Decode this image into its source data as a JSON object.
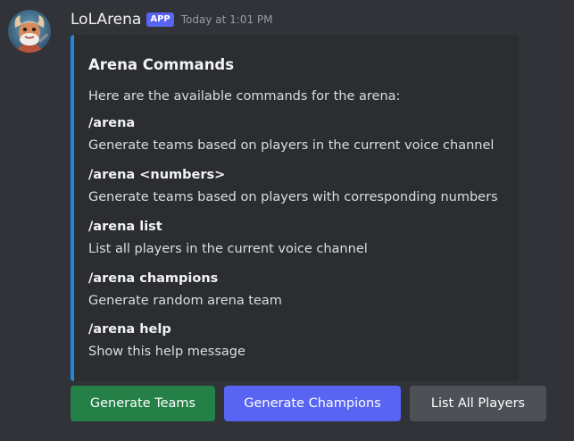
{
  "message": {
    "username": "LoLArena",
    "badge": "APP",
    "timestamp": "Today at 1:01 PM"
  },
  "embed": {
    "title": "Arena Commands",
    "description": "Here are the available commands for the arena:",
    "accent_color": "#1e88e5",
    "commands": [
      {
        "name": "/arena",
        "description": "Generate teams based on players in the current voice channel"
      },
      {
        "name": "/arena <numbers>",
        "description": "Generate teams based on players with corresponding numbers"
      },
      {
        "name": "/arena list",
        "description": "List all players in the current voice channel"
      },
      {
        "name": "/arena champions",
        "description": "Generate random arena team"
      },
      {
        "name": "/arena help",
        "description": "Show this help message"
      }
    ]
  },
  "buttons": {
    "generate_teams": {
      "label": "Generate Teams",
      "color": "#248046"
    },
    "generate_champions": {
      "label": "Generate Champions",
      "color": "#5865f2"
    },
    "list_all_players": {
      "label": "List All Players",
      "color": "#4e5058"
    }
  },
  "colors": {
    "background": "#313338",
    "embed_background": "#2b2d31",
    "badge": "#5865f2"
  },
  "avatar": {
    "icon": "avatar-icon"
  }
}
